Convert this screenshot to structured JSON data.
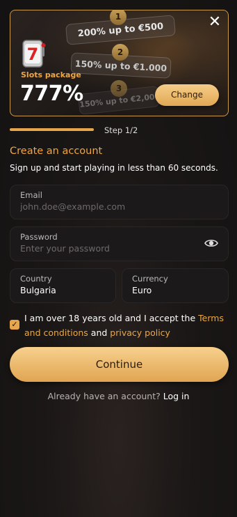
{
  "banner": {
    "package_label": "Slots package",
    "package_value": "777%",
    "offers": [
      {
        "step": "1",
        "text": "200% up to €500"
      },
      {
        "step": "2",
        "text": "150% up to €1.000"
      },
      {
        "step": "3",
        "text": "150% up to €2,000"
      }
    ],
    "change_label": "Change",
    "close_icon": "close-icon",
    "slot_icon": "slot-machine-icon"
  },
  "progress": {
    "step_text": "Step 1/2",
    "fraction": 0.5
  },
  "form": {
    "title": "Create an account",
    "subtitle": "Sign up and start playing in less than 60 seconds.",
    "email": {
      "label": "Email",
      "placeholder": "john.doe@example.com",
      "value": ""
    },
    "password": {
      "label": "Password",
      "placeholder": "Enter your password",
      "value": ""
    },
    "country": {
      "label": "Country",
      "value": "Bulgaria"
    },
    "currency": {
      "label": "Currency",
      "value": "Euro"
    },
    "terms": {
      "checked": true,
      "text_1": "I am over 18 years old and I accept the",
      "link_terms": "Terms and conditions",
      "text_2": "and",
      "link_privacy": "privacy policy"
    },
    "continue_label": "Continue",
    "login_prompt": "Already have an account?",
    "login_link": "Log in"
  },
  "colors": {
    "accent": "#f0a640",
    "button": "#e8b465",
    "background": "#171515"
  }
}
